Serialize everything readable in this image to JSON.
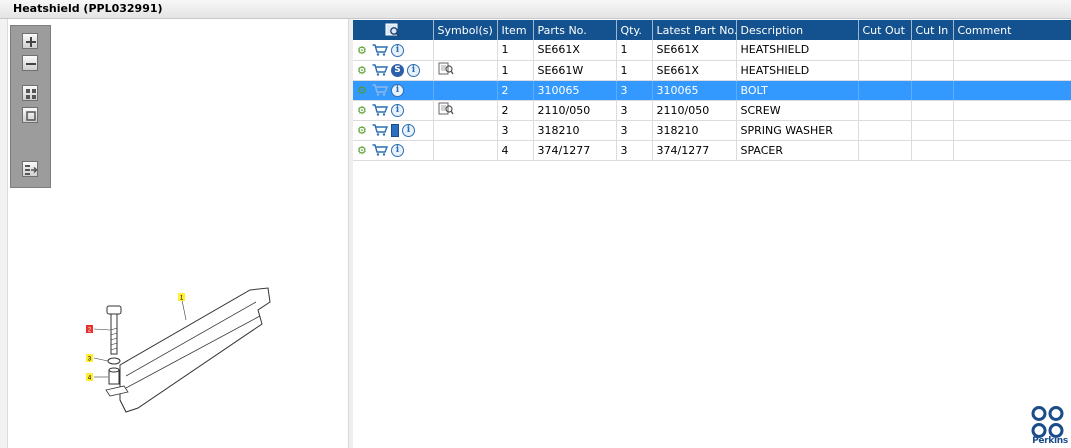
{
  "window": {
    "title": "Heatshield (PPL032991)"
  },
  "toolbar": {
    "buttons": [
      {
        "icon": "zoom-in-icon"
      },
      {
        "icon": "zoom-out-icon"
      },
      {
        "icon": "grid-view-icon"
      },
      {
        "icon": "fit-page-icon"
      },
      {
        "icon": "export-icon"
      }
    ]
  },
  "diagram": {
    "callouts": [
      "1",
      "2",
      "3",
      "4"
    ]
  },
  "table": {
    "headers": [
      "",
      "Symbol(s)",
      "Item",
      "Parts No.",
      "Qty.",
      "Latest Part No.",
      "Description",
      "Cut Out",
      "Cut In",
      "Comment"
    ],
    "rows": [
      {
        "item": "1",
        "parts_no": "SE661X",
        "qty": "1",
        "latest": "SE661X",
        "description": "HEATSHIELD",
        "cut_out": "",
        "cut_in": "",
        "comment": ""
      },
      {
        "item": "1",
        "parts_no": "SE661W",
        "qty": "1",
        "latest": "SE661X",
        "description": "HEATSHIELD",
        "cut_out": "",
        "cut_in": "",
        "comment": ""
      },
      {
        "item": "2",
        "parts_no": "310065",
        "qty": "3",
        "latest": "310065",
        "description": "BOLT",
        "cut_out": "",
        "cut_in": "",
        "comment": ""
      },
      {
        "item": "2",
        "parts_no": "2110/050",
        "qty": "3",
        "latest": "2110/050",
        "description": "SCREW",
        "cut_out": "",
        "cut_in": "",
        "comment": ""
      },
      {
        "item": "3",
        "parts_no": "318210",
        "qty": "3",
        "latest": "318210",
        "description": "SPRING WASHER",
        "cut_out": "",
        "cut_in": "",
        "comment": ""
      },
      {
        "item": "4",
        "parts_no": "374/1277",
        "qty": "3",
        "latest": "374/1277",
        "description": "SPACER",
        "cut_out": "",
        "cut_in": "",
        "comment": ""
      }
    ],
    "selected_row": 2
  },
  "logo": {
    "text": "Perkins"
  },
  "colors": {
    "header_bg": "#14528f",
    "selected_bg": "#3399ff",
    "gear_green": "#4f9a2b",
    "logo_blue": "#1a4c8a"
  }
}
